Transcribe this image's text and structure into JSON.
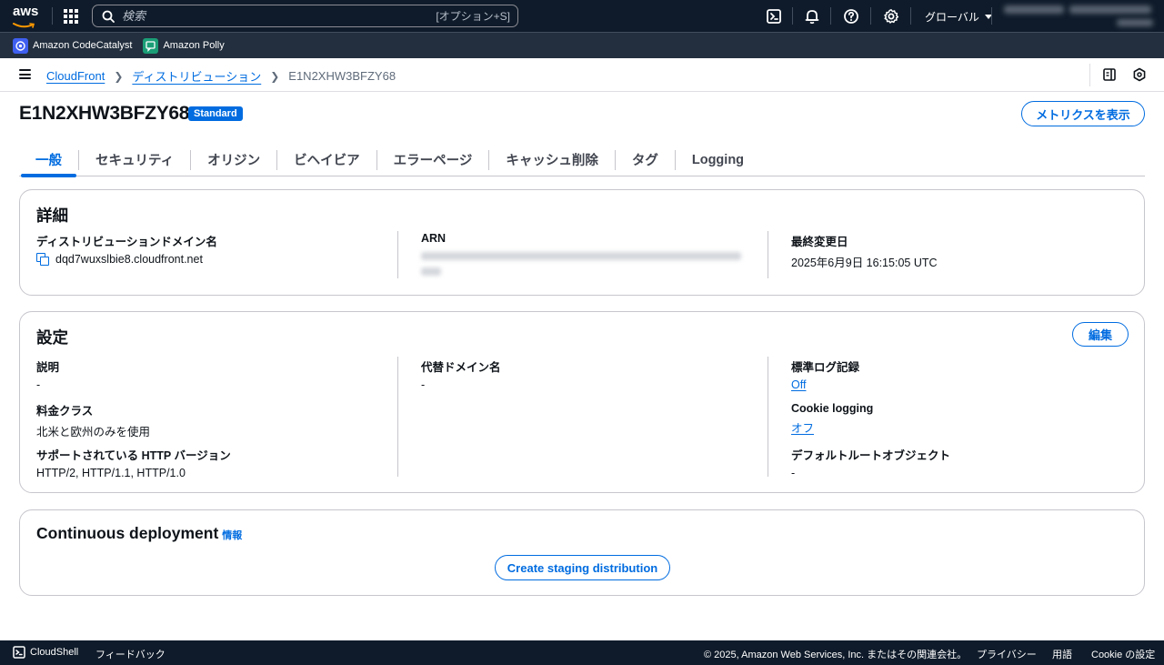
{
  "topnav": {
    "logo_text": "aws",
    "search_placeholder": "検索",
    "search_shortcut": "[オプション+S]",
    "region_label": "グローバル",
    "icons": [
      "services-grid-icon",
      "search-icon",
      "cloudshell-icon",
      "bell-icon",
      "help-icon",
      "gear-icon"
    ]
  },
  "favorites": [
    {
      "label": "Amazon CodeCatalyst",
      "color": "#3f5ff0"
    },
    {
      "label": "Amazon Polly",
      "color": "#1b9e76"
    }
  ],
  "breadcrumb": {
    "items": [
      "CloudFront",
      "ディストリビューション"
    ],
    "current": "E1N2XHW3BFZY68"
  },
  "header": {
    "title": "E1N2XHW3BFZY68",
    "badge": "Standard",
    "metrics_button": "メトリクスを表示"
  },
  "tabs": [
    "一般",
    "セキュリティ",
    "オリジン",
    "ビヘイビア",
    "エラーページ",
    "キャッシュ削除",
    "タグ",
    "Logging"
  ],
  "details": {
    "title": "詳細",
    "domain_label": "ディストリビューションドメイン名",
    "domain_value": "dqd7wuxslbie8.cloudfront.net",
    "arn_label": "ARN",
    "modified_label": "最終変更日",
    "modified_value": "2025年6月9日 16:15:05 UTC"
  },
  "settings": {
    "title": "設定",
    "edit_button": "編集",
    "description_label": "説明",
    "description_value": "-",
    "price_class_label": "料金クラス",
    "price_class_value": "北米と欧州のみを使用",
    "http_label": "サポートされている HTTP バージョン",
    "http_value": "HTTP/2, HTTP/1.1, HTTP/1.0",
    "alt_domain_label": "代替ドメイン名",
    "alt_domain_value": "-",
    "std_log_label": "標準ログ記録",
    "std_log_value": "Off",
    "cookie_label": "Cookie logging",
    "cookie_value": "オフ",
    "default_root_label": "デフォルトルートオブジェクト",
    "default_root_value": "-"
  },
  "continuous": {
    "title": "Continuous deployment",
    "info": "情報",
    "button": "Create staging distribution"
  },
  "footer": {
    "cloudshell": "CloudShell",
    "feedback": "フィードバック",
    "copyright": "© 2025, Amazon Web Services, Inc. またはその関連会社。",
    "privacy": "プライバシー",
    "terms": "用語",
    "cookie": "Cookie の設定"
  },
  "colors": {
    "nav_bg": "#0f1b2a",
    "accent": "#006ce0"
  }
}
